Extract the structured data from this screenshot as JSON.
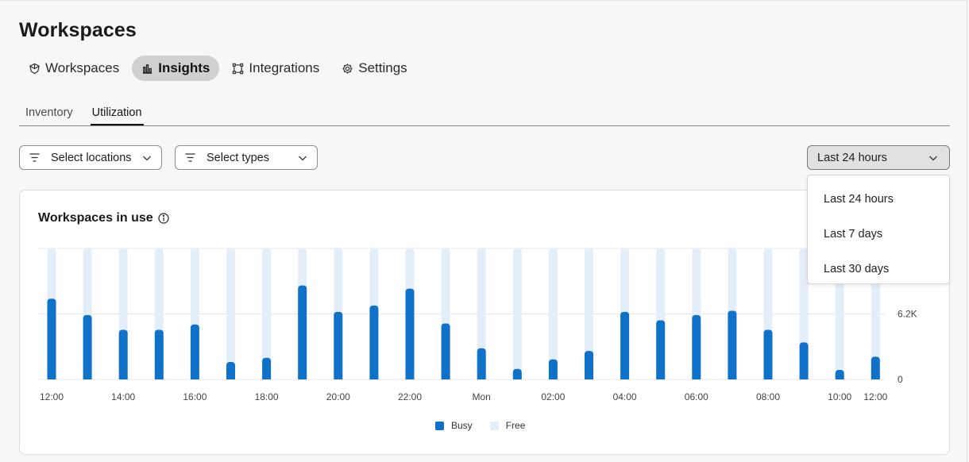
{
  "header": {
    "title": "Workspaces"
  },
  "main_tabs": [
    {
      "label": "Workspaces",
      "icon": "workspace-icon",
      "active": false
    },
    {
      "label": "Insights",
      "icon": "bar-chart-icon",
      "active": true
    },
    {
      "label": "Integrations",
      "icon": "integrations-icon",
      "active": false
    },
    {
      "label": "Settings",
      "icon": "gear-icon",
      "active": false
    }
  ],
  "sub_tabs": [
    {
      "label": "Inventory",
      "active": false
    },
    {
      "label": "Utilization",
      "active": true
    }
  ],
  "filters": {
    "locations_label": "Select locations",
    "types_label": "Select types",
    "range_label": "Last 24 hours"
  },
  "range_menu": {
    "options": [
      "Last 24 hours",
      "Last 7 days",
      "Last 30 days"
    ]
  },
  "card": {
    "title": "Workspaces in use",
    "info_icon": "info-icon"
  },
  "legend": {
    "busy_label": "Busy",
    "free_label": "Free"
  },
  "colors": {
    "busy": "#0f71c8",
    "free": "#e3eef9",
    "active_tab_bg": "#d0d0d0"
  },
  "chart_data": {
    "type": "bar",
    "stacked": true,
    "x_tick_labels": [
      "12:00",
      "14:00",
      "16:00",
      "18:00",
      "20:00",
      "22:00",
      "Mon",
      "02:00",
      "04:00",
      "06:00",
      "08:00",
      "10:00",
      "12:00"
    ],
    "y_tick_labels": [
      "0",
      "6.2K"
    ],
    "y_ticks": [
      0,
      6200
    ],
    "ylim": [
      0,
      12400
    ],
    "bar_count": 24,
    "series": [
      {
        "name": "Busy",
        "values": [
          7650,
          6100,
          4700,
          4700,
          5200,
          1650,
          2050,
          8900,
          6400,
          7000,
          8600,
          5300,
          2950,
          1000,
          1900,
          2700,
          6400,
          5600,
          6100,
          6500,
          4700,
          3500,
          900,
          2150
        ]
      },
      {
        "name": "Free",
        "values": [
          4750,
          6300,
          7700,
          7700,
          7200,
          10750,
          10350,
          3500,
          6000,
          5400,
          3800,
          7100,
          9450,
          11400,
          10500,
          9700,
          6000,
          6800,
          6300,
          5900,
          7700,
          8900,
          11500,
          10250
        ]
      }
    ],
    "legend": "bottom-center",
    "grid": true
  }
}
